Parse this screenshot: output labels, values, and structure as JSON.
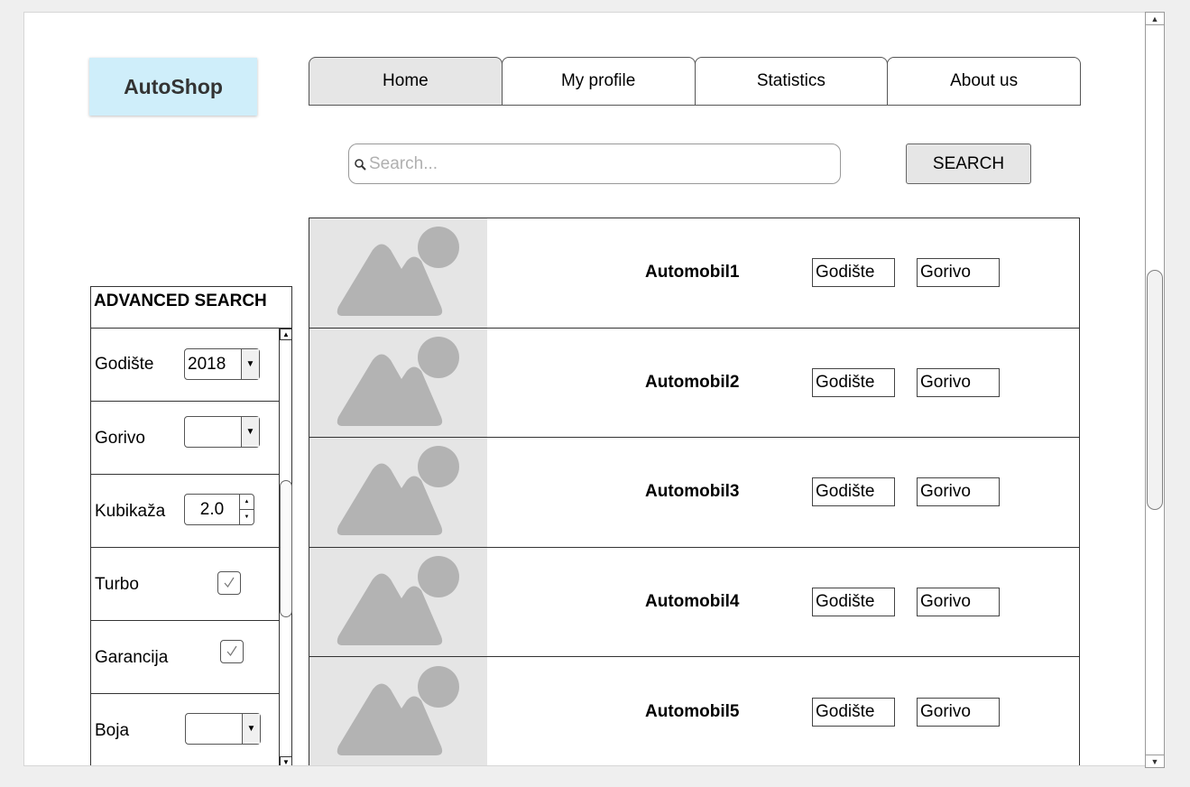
{
  "logo": {
    "text": "AutoShop"
  },
  "nav": {
    "tabs": [
      {
        "label": "Home",
        "active": true
      },
      {
        "label": "My profile"
      },
      {
        "label": "Statistics"
      },
      {
        "label": "About us"
      }
    ]
  },
  "search": {
    "placeholder": "Search...",
    "value": "",
    "button_label": "SEARCH"
  },
  "advanced": {
    "title": "ADVANCED SEARCH",
    "godiste": {
      "label": "Godište",
      "value": "2018"
    },
    "gorivo": {
      "label": "Gorivo",
      "value": ""
    },
    "kubikaza": {
      "label": "Kubikaža",
      "value": "2.0"
    },
    "turbo": {
      "label": "Turbo",
      "checked": true
    },
    "garancija": {
      "label": "Garancija",
      "checked": true
    },
    "boja": {
      "label": "Boja",
      "value": ""
    }
  },
  "cars": [
    {
      "name": "Automobil1",
      "field1": "Godište",
      "field2": "Gorivo"
    },
    {
      "name": "Automobil2",
      "field1": "Godište",
      "field2": "Gorivo"
    },
    {
      "name": "Automobil3",
      "field1": "Godište",
      "field2": "Gorivo"
    },
    {
      "name": "Automobil4",
      "field1": "Godište",
      "field2": "Gorivo"
    },
    {
      "name": "Automobil5",
      "field1": "Godište",
      "field2": "Gorivo"
    }
  ],
  "colors": {
    "logo_bg": "#cfeefa",
    "active_tab": "#e6e6e6",
    "image_placeholder": "#e5e5e5",
    "image_icon": "#b3b3b3"
  },
  "icons": {
    "search": "magnifier-icon",
    "image": "image-placeholder-icon",
    "checkbox": "checkmark-icon"
  }
}
